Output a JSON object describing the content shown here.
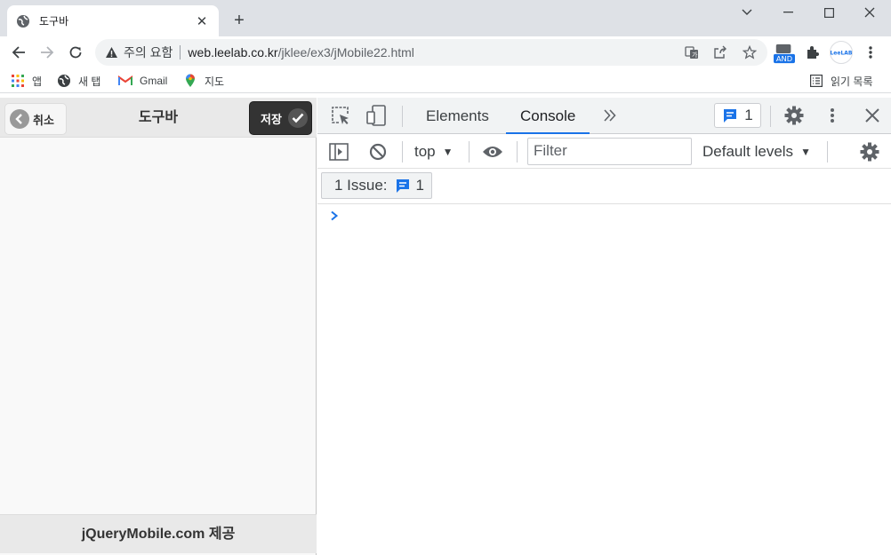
{
  "browser": {
    "tab": {
      "title": "도구바"
    },
    "omnibox": {
      "security_label": "주의 요함",
      "url_host": "web.leelab.co.kr",
      "url_path": "/jklee/ex3/jMobile22.html"
    },
    "extensions": {
      "badge": "AND"
    },
    "bookmarks": [
      {
        "label": "앱",
        "icon": "apps-grid-icon"
      },
      {
        "label": "새 탭",
        "icon": "globe-icon"
      },
      {
        "label": "Gmail",
        "icon": "gmail-icon"
      },
      {
        "label": "지도",
        "icon": "maps-pin-icon"
      }
    ],
    "reading_list": "읽기 목록"
  },
  "page": {
    "header_title": "도구바",
    "cancel_label": "취소",
    "save_label": "저장",
    "footer_text": "jQueryMobile.com 제공"
  },
  "devtools": {
    "tabs": [
      "Elements",
      "Console"
    ],
    "active_tab": "Console",
    "issues_count": "1",
    "context": "top",
    "filter_placeholder": "Filter",
    "levels": "Default levels",
    "issue_label": "1 Issue:",
    "issue_count": "1",
    "prompt": "›"
  },
  "colors": {
    "accent": "#1a73e8",
    "save_button": "#333333"
  }
}
